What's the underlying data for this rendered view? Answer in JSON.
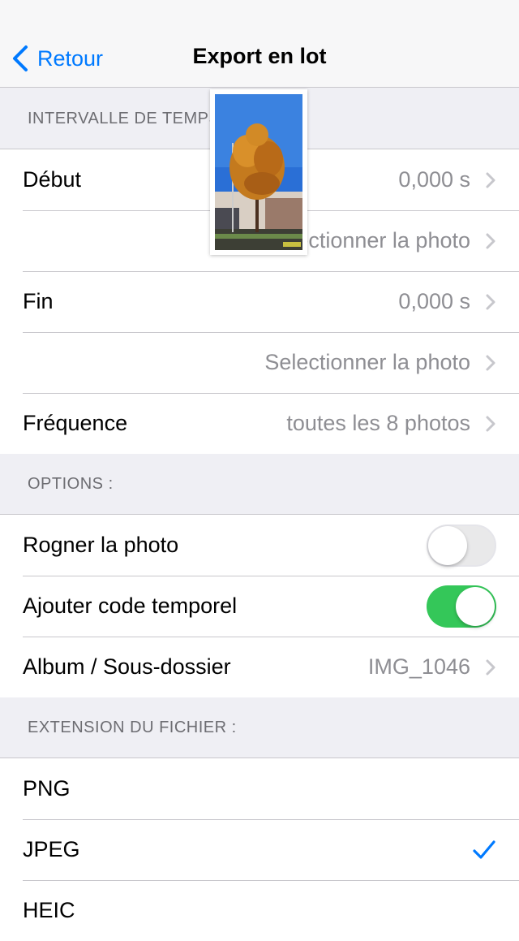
{
  "nav": {
    "back_label": "Retour",
    "title": "Export en lot"
  },
  "sections": {
    "interval": "INTERVALLE DE TEMPS",
    "options": "OPTIONS :",
    "extension": "EXTENSION DU FICHIER :"
  },
  "interval_rows": {
    "start_label": "Début",
    "start_value": "0,000 s",
    "start_select": "Selectionner la photo",
    "end_label": "Fin",
    "end_value": "0,000 s",
    "end_select": "Selectionner la photo",
    "freq_label": "Fréquence",
    "freq_value": "toutes les 8 photos"
  },
  "options_rows": {
    "crop_label": "Rogner la photo",
    "crop_on": false,
    "timecode_label": "Ajouter code temporel",
    "timecode_on": true,
    "album_label": "Album / Sous-dossier",
    "album_value": "IMG_1046"
  },
  "extension_rows": {
    "png": "PNG",
    "jpeg": "JPEG",
    "heic": "HEIC",
    "selected": "JPEG"
  },
  "colors": {
    "accent": "#007aff",
    "toggle_on": "#34c759"
  },
  "icons": {
    "back": "chevron-left-icon",
    "disclosure": "chevron-right-icon",
    "check": "checkmark-icon"
  }
}
